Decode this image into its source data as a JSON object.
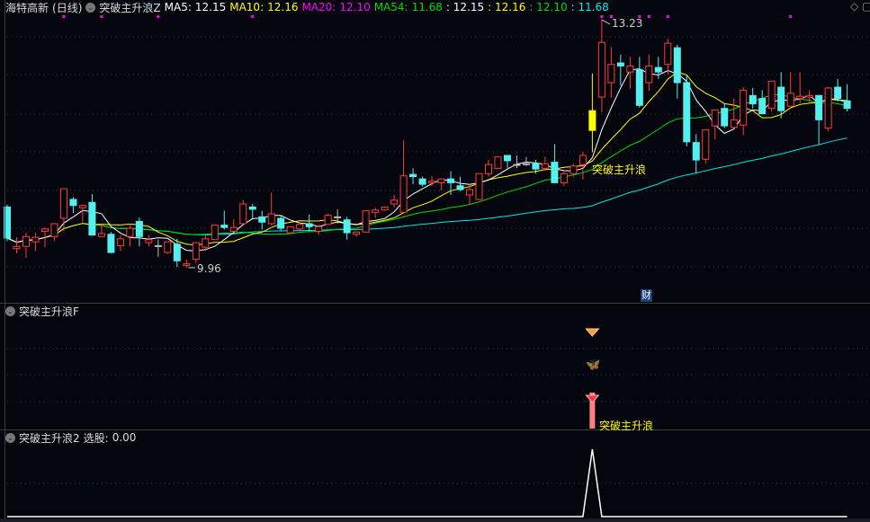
{
  "header": {
    "stock": "海特高新",
    "period": "(日线)",
    "indicator": "突破主升浪Z",
    "ma5_label": "MA5:",
    "ma5": "12.15",
    "ma10_label": "MA10:",
    "ma10": "12.16",
    "ma20_label": "MA20:",
    "ma20": "12.10",
    "ma54_label": "MA54:",
    "ma54": "11.68",
    "v1": ": 12.15",
    "v2": ": 12.16",
    "v3": ": 12.10",
    "v4": ": 11.68"
  },
  "colors": {
    "up": "#ff3b3b",
    "down": "#54f0f0",
    "ma5": "#ffffff",
    "ma10": "#ffff00",
    "ma20": "#00dd00",
    "ma54": "#00e5ee",
    "signal": "#ffff00",
    "marker": "#ff00ff"
  },
  "annotations": {
    "high": "13.23",
    "low": "9.96",
    "signal_text": "突破主升浪",
    "fin_badge": "财"
  },
  "panel2": {
    "title": "突破主升浪F",
    "signal_text": "突破主升浪"
  },
  "panel3": {
    "title": "突破主升浪2",
    "field_label": "选股:",
    "field_value": "0.00"
  },
  "chart_data": {
    "type": "candlestick",
    "signal_index": 62,
    "marker_indices": [
      6,
      10,
      16,
      26,
      63,
      64,
      67,
      68,
      70,
      83
    ],
    "ohlc": [
      [
        10.76,
        10.79,
        10.31,
        10.35
      ],
      [
        10.21,
        10.36,
        10.15,
        10.24
      ],
      [
        10.24,
        10.42,
        10.09,
        10.37
      ],
      [
        10.3,
        10.42,
        10.18,
        10.36
      ],
      [
        10.44,
        10.49,
        10.23,
        10.47
      ],
      [
        10.37,
        10.54,
        10.31,
        10.54
      ],
      [
        10.61,
        11.0,
        10.44,
        11.0
      ],
      [
        10.86,
        10.89,
        10.68,
        10.78
      ],
      [
        10.75,
        10.79,
        10.56,
        10.78
      ],
      [
        10.82,
        10.93,
        10.39,
        10.39
      ],
      [
        10.37,
        10.54,
        10.37,
        10.41
      ],
      [
        10.4,
        10.43,
        10.15,
        10.16
      ],
      [
        10.25,
        10.39,
        10.18,
        10.34
      ],
      [
        10.37,
        10.54,
        10.24,
        10.48
      ],
      [
        10.57,
        10.62,
        10.24,
        10.37
      ],
      [
        10.29,
        10.39,
        10.24,
        10.33
      ],
      [
        10.25,
        10.33,
        10.1,
        10.25
      ],
      [
        10.16,
        10.3,
        10.14,
        10.3
      ],
      [
        10.27,
        10.34,
        9.97,
        10.05
      ],
      [
        9.99,
        10.07,
        9.96,
        10.01
      ],
      [
        10.07,
        10.29,
        10.02,
        10.29
      ],
      [
        10.23,
        10.39,
        10.18,
        10.34
      ],
      [
        10.33,
        10.52,
        10.33,
        10.52
      ],
      [
        10.52,
        10.71,
        10.46,
        10.49
      ],
      [
        10.44,
        10.6,
        10.44,
        10.49
      ],
      [
        10.54,
        10.85,
        10.54,
        10.8
      ],
      [
        10.76,
        10.8,
        10.61,
        10.73
      ],
      [
        10.63,
        10.71,
        10.46,
        10.56
      ],
      [
        10.54,
        10.95,
        10.52,
        10.67
      ],
      [
        10.61,
        10.65,
        10.44,
        10.48
      ],
      [
        10.42,
        10.5,
        10.42,
        10.5
      ],
      [
        10.47,
        10.56,
        10.44,
        10.53
      ],
      [
        10.54,
        10.66,
        10.44,
        10.5
      ],
      [
        10.44,
        10.53,
        10.39,
        10.5
      ],
      [
        10.53,
        10.67,
        10.53,
        10.65
      ],
      [
        10.63,
        10.73,
        10.54,
        10.63
      ],
      [
        10.59,
        10.63,
        10.33,
        10.42
      ],
      [
        10.4,
        10.44,
        10.37,
        10.43
      ],
      [
        10.43,
        10.71,
        10.43,
        10.71
      ],
      [
        10.69,
        10.75,
        10.62,
        10.72
      ],
      [
        10.72,
        10.76,
        10.71,
        10.76
      ],
      [
        10.8,
        10.92,
        10.75,
        10.85
      ],
      [
        10.69,
        11.64,
        10.69,
        11.17
      ],
      [
        11.19,
        11.27,
        11.06,
        11.16
      ],
      [
        11.13,
        11.16,
        11.03,
        11.06
      ],
      [
        11.08,
        11.17,
        11.04,
        11.1
      ],
      [
        11.08,
        11.13,
        10.98,
        11.13
      ],
      [
        11.13,
        11.23,
        10.92,
        11.08
      ],
      [
        11.04,
        11.16,
        10.97,
        10.99
      ],
      [
        10.92,
        11.05,
        10.79,
        10.99
      ],
      [
        10.86,
        11.2,
        10.85,
        11.2
      ],
      [
        11.2,
        11.38,
        11.16,
        11.32
      ],
      [
        11.27,
        11.42,
        11.27,
        11.42
      ],
      [
        11.44,
        11.44,
        11.27,
        11.37
      ],
      [
        11.32,
        11.44,
        11.27,
        11.32
      ],
      [
        11.33,
        11.42,
        11.3,
        11.33
      ],
      [
        11.33,
        11.38,
        11.2,
        11.26
      ],
      [
        11.27,
        11.42,
        11.24,
        11.33
      ],
      [
        11.35,
        11.59,
        11.08,
        11.08
      ],
      [
        11.08,
        11.24,
        11.04,
        11.2
      ],
      [
        11.2,
        11.33,
        11.16,
        11.3
      ],
      [
        11.32,
        11.49,
        11.12,
        11.44
      ],
      [
        11.77,
        12.52,
        11.48,
        12.03
      ],
      [
        12.21,
        13.23,
        12.01,
        12.93
      ],
      [
        12.4,
        12.87,
        12.2,
        12.64
      ],
      [
        12.66,
        12.77,
        12.36,
        12.62
      ],
      [
        12.54,
        12.74,
        12.32,
        12.62
      ],
      [
        12.57,
        12.74,
        12.07,
        12.1
      ],
      [
        12.4,
        12.77,
        12.29,
        12.62
      ],
      [
        12.6,
        12.74,
        12.45,
        12.54
      ],
      [
        12.64,
        12.98,
        12.51,
        12.92
      ],
      [
        12.86,
        12.9,
        12.19,
        12.4
      ],
      [
        12.4,
        12.51,
        11.56,
        11.62
      ],
      [
        11.61,
        11.72,
        11.2,
        11.38
      ],
      [
        11.39,
        11.78,
        11.33,
        11.78
      ],
      [
        11.83,
        12.04,
        11.65,
        12.04
      ],
      [
        12.06,
        12.12,
        11.8,
        11.83
      ],
      [
        11.81,
        12.19,
        11.8,
        11.91
      ],
      [
        11.84,
        12.34,
        11.71,
        12.3
      ],
      [
        12.23,
        12.33,
        12.06,
        12.12
      ],
      [
        12.19,
        12.3,
        11.99,
        11.99
      ],
      [
        12.06,
        12.42,
        12.02,
        12.42
      ],
      [
        12.34,
        12.54,
        11.93,
        12.03
      ],
      [
        12.09,
        12.54,
        12.09,
        12.26
      ],
      [
        12.19,
        12.54,
        12.13,
        12.22
      ],
      [
        12.21,
        12.3,
        12.15,
        12.23
      ],
      [
        12.23,
        12.23,
        11.59,
        11.91
      ],
      [
        11.8,
        12.34,
        11.76,
        12.33
      ],
      [
        12.34,
        12.45,
        12.15,
        12.19
      ],
      [
        12.16,
        12.38,
        12.02,
        12.06
      ]
    ],
    "ma_periods": [
      5,
      10,
      20,
      54
    ],
    "selection_series_peak_index": 62
  }
}
